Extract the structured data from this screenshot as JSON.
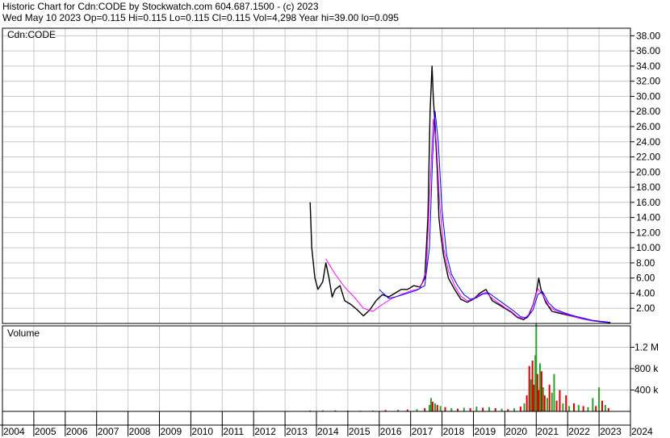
{
  "header": {
    "line1": "Historic Chart for Cdn:CODE by Stockwatch.com 604.687.1500 - (c) 2023",
    "line2": "Wed May 10 2023   Op=0.115   Hi=0.115   Lo=0.115   Cl=0.115   Vol=4,298   Year hi=39.00   lo=0.095"
  },
  "chart_data": [
    {
      "type": "line",
      "title": "Cdn:CODE",
      "ylim": [
        0,
        39
      ],
      "y_ticks": [
        {
          "v": 2,
          "label": "2.00"
        },
        {
          "v": 4,
          "label": "4.00"
        },
        {
          "v": 6,
          "label": "6.00"
        },
        {
          "v": 8,
          "label": "8.00"
        },
        {
          "v": 10,
          "label": "10.00"
        },
        {
          "v": 12,
          "label": "12.00"
        },
        {
          "v": 14,
          "label": "14.00"
        },
        {
          "v": 16,
          "label": "16.00"
        },
        {
          "v": 18,
          "label": "18.00"
        },
        {
          "v": 20,
          "label": "20.00"
        },
        {
          "v": 22,
          "label": "22.00"
        },
        {
          "v": 24,
          "label": "24.00"
        },
        {
          "v": 26,
          "label": "26.00"
        },
        {
          "v": 28,
          "label": "28.00"
        },
        {
          "v": 30,
          "label": "30.00"
        },
        {
          "v": 32,
          "label": "32.00"
        },
        {
          "v": 34,
          "label": "34.00"
        },
        {
          "v": 36,
          "label": "36.00"
        },
        {
          "v": 38,
          "label": "38.00"
        }
      ],
      "price": [
        [
          2013.8,
          16
        ],
        [
          2013.85,
          10
        ],
        [
          2013.95,
          6
        ],
        [
          2014.05,
          4.5
        ],
        [
          2014.2,
          5.5
        ],
        [
          2014.3,
          8
        ],
        [
          2014.4,
          6
        ],
        [
          2014.5,
          3.5
        ],
        [
          2014.6,
          4.5
        ],
        [
          2014.75,
          5
        ],
        [
          2014.9,
          3
        ],
        [
          2015.1,
          2.5
        ],
        [
          2015.3,
          1.8
        ],
        [
          2015.5,
          1.0
        ],
        [
          2015.7,
          1.8
        ],
        [
          2015.9,
          3
        ],
        [
          2016.1,
          3.8
        ],
        [
          2016.3,
          3.5
        ],
        [
          2016.5,
          4
        ],
        [
          2016.7,
          4.5
        ],
        [
          2016.9,
          4.5
        ],
        [
          2017.1,
          5
        ],
        [
          2017.3,
          4.8
        ],
        [
          2017.45,
          6
        ],
        [
          2017.55,
          14
        ],
        [
          2017.62,
          28
        ],
        [
          2017.68,
          34
        ],
        [
          2017.72,
          30
        ],
        [
          2017.78,
          26
        ],
        [
          2017.85,
          20
        ],
        [
          2017.9,
          14
        ],
        [
          2017.95,
          12
        ],
        [
          2018.05,
          9
        ],
        [
          2018.2,
          6
        ],
        [
          2018.4,
          4.5
        ],
        [
          2018.6,
          3.2
        ],
        [
          2018.8,
          2.8
        ],
        [
          2019.0,
          3.2
        ],
        [
          2019.2,
          4
        ],
        [
          2019.4,
          4.5
        ],
        [
          2019.6,
          3
        ],
        [
          2019.8,
          2.5
        ],
        [
          2020.0,
          2
        ],
        [
          2020.2,
          1.5
        ],
        [
          2020.4,
          0.8
        ],
        [
          2020.6,
          0.5
        ],
        [
          2020.75,
          1
        ],
        [
          2020.9,
          2.5
        ],
        [
          2021.0,
          4
        ],
        [
          2021.08,
          6
        ],
        [
          2021.15,
          4.5
        ],
        [
          2021.3,
          2.8
        ],
        [
          2021.5,
          1.6
        ],
        [
          2021.7,
          1.4
        ],
        [
          2021.9,
          1.2
        ],
        [
          2022.2,
          0.9
        ],
        [
          2022.5,
          0.6
        ],
        [
          2022.8,
          0.35
        ],
        [
          2023.1,
          0.2
        ],
        [
          2023.36,
          0.115
        ]
      ],
      "ma_short": [
        [
          2014.3,
          8.5
        ],
        [
          2014.6,
          6.5
        ],
        [
          2014.9,
          4.8
        ],
        [
          2015.2,
          3.5
        ],
        [
          2015.5,
          2.0
        ],
        [
          2015.8,
          1.6
        ],
        [
          2016.1,
          2.5
        ],
        [
          2016.4,
          3.3
        ],
        [
          2016.7,
          3.8
        ],
        [
          2017.0,
          4.3
        ],
        [
          2017.3,
          4.6
        ],
        [
          2017.5,
          7
        ],
        [
          2017.62,
          18
        ],
        [
          2017.72,
          27
        ],
        [
          2017.82,
          24
        ],
        [
          2017.92,
          16
        ],
        [
          2018.05,
          10
        ],
        [
          2018.2,
          7
        ],
        [
          2018.4,
          5
        ],
        [
          2018.6,
          3.6
        ],
        [
          2018.8,
          3
        ],
        [
          2019.0,
          3.2
        ],
        [
          2019.2,
          3.8
        ],
        [
          2019.4,
          4.1
        ],
        [
          2019.6,
          3.3
        ],
        [
          2019.8,
          2.7
        ],
        [
          2020.0,
          2.1
        ],
        [
          2020.2,
          1.6
        ],
        [
          2020.4,
          0.9
        ],
        [
          2020.6,
          0.6
        ],
        [
          2020.8,
          1.3
        ],
        [
          2020.95,
          3.2
        ],
        [
          2021.05,
          4.6
        ],
        [
          2021.2,
          3.8
        ],
        [
          2021.4,
          2.3
        ],
        [
          2021.6,
          1.7
        ],
        [
          2021.9,
          1.3
        ],
        [
          2022.2,
          0.9
        ],
        [
          2022.5,
          0.6
        ],
        [
          2022.8,
          0.35
        ],
        [
          2023.36,
          0.13
        ]
      ],
      "ma_long": [
        [
          2016.0,
          4.5
        ],
        [
          2016.3,
          3.3
        ],
        [
          2016.6,
          3.6
        ],
        [
          2016.9,
          4
        ],
        [
          2017.2,
          4.4
        ],
        [
          2017.45,
          5
        ],
        [
          2017.6,
          10
        ],
        [
          2017.7,
          22
        ],
        [
          2017.78,
          28
        ],
        [
          2017.88,
          24
        ],
        [
          2018.0,
          15
        ],
        [
          2018.15,
          9
        ],
        [
          2018.3,
          6.5
        ],
        [
          2018.5,
          5
        ],
        [
          2018.7,
          3.8
        ],
        [
          2018.9,
          3.2
        ],
        [
          2019.1,
          3.4
        ],
        [
          2019.3,
          3.9
        ],
        [
          2019.5,
          4
        ],
        [
          2019.7,
          3.4
        ],
        [
          2019.9,
          2.8
        ],
        [
          2020.1,
          2.2
        ],
        [
          2020.3,
          1.6
        ],
        [
          2020.5,
          0.9
        ],
        [
          2020.7,
          0.7
        ],
        [
          2020.9,
          1.8
        ],
        [
          2021.05,
          3.8
        ],
        [
          2021.2,
          4.2
        ],
        [
          2021.4,
          2.7
        ],
        [
          2021.6,
          1.9
        ],
        [
          2021.9,
          1.4
        ],
        [
          2022.2,
          1
        ],
        [
          2022.5,
          0.7
        ],
        [
          2022.8,
          0.4
        ],
        [
          2023.36,
          0.15
        ]
      ]
    },
    {
      "type": "bar",
      "title": "Volume",
      "ylim": [
        0,
        1600000
      ],
      "y_ticks": [
        {
          "v": 400000,
          "label": "400 k"
        },
        {
          "v": 800000,
          "label": "800 k"
        },
        {
          "v": 1200000,
          "label": "1.2 M"
        }
      ],
      "bars": [
        [
          2013.8,
          15000,
          "red"
        ],
        [
          2014.2,
          20000,
          "green"
        ],
        [
          2014.6,
          18000,
          "red"
        ],
        [
          2015.0,
          15000,
          "green"
        ],
        [
          2015.4,
          12000,
          "red"
        ],
        [
          2015.8,
          16000,
          "green"
        ],
        [
          2016.2,
          25000,
          "red"
        ],
        [
          2016.6,
          30000,
          "green"
        ],
        [
          2016.9,
          35000,
          "red"
        ],
        [
          2017.2,
          40000,
          "green"
        ],
        [
          2017.45,
          60000,
          "red"
        ],
        [
          2017.6,
          120000,
          "green"
        ],
        [
          2017.65,
          250000,
          "green"
        ],
        [
          2017.7,
          180000,
          "red"
        ],
        [
          2017.78,
          150000,
          "green"
        ],
        [
          2017.85,
          120000,
          "red"
        ],
        [
          2017.95,
          100000,
          "green"
        ],
        [
          2018.1,
          80000,
          "red"
        ],
        [
          2018.3,
          60000,
          "green"
        ],
        [
          2018.5,
          50000,
          "red"
        ],
        [
          2018.7,
          70000,
          "green"
        ],
        [
          2018.9,
          60000,
          "red"
        ],
        [
          2019.1,
          90000,
          "green"
        ],
        [
          2019.3,
          70000,
          "red"
        ],
        [
          2019.5,
          80000,
          "green"
        ],
        [
          2019.7,
          60000,
          "red"
        ],
        [
          2019.9,
          50000,
          "green"
        ],
        [
          2020.1,
          40000,
          "red"
        ],
        [
          2020.3,
          60000,
          "green"
        ],
        [
          2020.5,
          90000,
          "red"
        ],
        [
          2020.62,
          150000,
          "green"
        ],
        [
          2020.7,
          300000,
          "red"
        ],
        [
          2020.78,
          850000,
          "red"
        ],
        [
          2020.83,
          600000,
          "green"
        ],
        [
          2020.88,
          950000,
          "red"
        ],
        [
          2020.93,
          500000,
          "red"
        ],
        [
          2020.97,
          1050000,
          "green"
        ],
        [
          2021.0,
          1650000,
          "green"
        ],
        [
          2021.04,
          700000,
          "red"
        ],
        [
          2021.08,
          400000,
          "red"
        ],
        [
          2021.12,
          900000,
          "green"
        ],
        [
          2021.17,
          750000,
          "red"
        ],
        [
          2021.22,
          450000,
          "green"
        ],
        [
          2021.27,
          300000,
          "red"
        ],
        [
          2021.35,
          250000,
          "green"
        ],
        [
          2021.42,
          500000,
          "red"
        ],
        [
          2021.5,
          350000,
          "green"
        ],
        [
          2021.57,
          700000,
          "green"
        ],
        [
          2021.65,
          200000,
          "red"
        ],
        [
          2021.75,
          400000,
          "red"
        ],
        [
          2021.85,
          150000,
          "green"
        ],
        [
          2021.95,
          300000,
          "red"
        ],
        [
          2022.05,
          100000,
          "green"
        ],
        [
          2022.2,
          150000,
          "red"
        ],
        [
          2022.35,
          120000,
          "green"
        ],
        [
          2022.5,
          100000,
          "red"
        ],
        [
          2022.65,
          80000,
          "green"
        ],
        [
          2022.8,
          250000,
          "green"
        ],
        [
          2022.9,
          100000,
          "red"
        ],
        [
          2023.0,
          450000,
          "green"
        ],
        [
          2023.1,
          200000,
          "red"
        ],
        [
          2023.2,
          120000,
          "green"
        ],
        [
          2023.3,
          60000,
          "red"
        ]
      ]
    }
  ],
  "x_axis": {
    "xlim": [
      2004,
      2024
    ],
    "ticks": [
      "2004",
      "2005",
      "2006",
      "2007",
      "2008",
      "2009",
      "2010",
      "2011",
      "2012",
      "2013",
      "2014",
      "2015",
      "2016",
      "2017",
      "2018",
      "2019",
      "2020",
      "2021",
      "2022",
      "2023",
      "2024"
    ]
  },
  "colors": {
    "price": "#000000",
    "ma_short": "#ff00ff",
    "ma_long": "#0000ff",
    "up": "#2ca02c",
    "down": "#e00000",
    "grid": "#c8c8c8"
  }
}
